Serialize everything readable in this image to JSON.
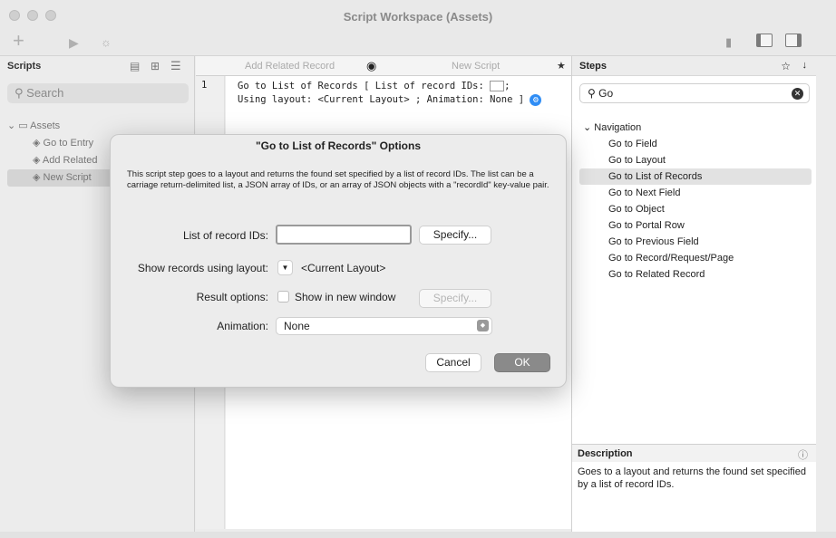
{
  "window": {
    "title": "Script Workspace (Assets)"
  },
  "scripts_panel": {
    "header": "Scripts",
    "search_placeholder": "Search",
    "folder": "Assets",
    "items": [
      "Go to Entry",
      "Add Related",
      "New Script"
    ]
  },
  "tabs": [
    {
      "label": "Add Related Record"
    },
    {
      "label": "New Script"
    }
  ],
  "editor": {
    "line_number": "1",
    "line1_text": "Go to List of Records [ List of record IDs:",
    "line1_end": ";",
    "line2_text": "Using layout: <Current Layout> ; Animation: None ]"
  },
  "steps_panel": {
    "header": "Steps",
    "search_value": "Go",
    "group": "Navigation",
    "items": [
      "Go to Field",
      "Go to Layout",
      "Go to List of Records",
      "Go to Next Field",
      "Go to Object",
      "Go to Portal Row",
      "Go to Previous Field",
      "Go to Record/Request/Page",
      "Go to Related Record"
    ],
    "selected_index": 2,
    "description_header": "Description",
    "description": "Goes to a layout and returns the found set specified by a list of record IDs."
  },
  "dialog": {
    "title": "\"Go to List of Records\" Options",
    "description": "This script step goes to a layout and returns the found set specified by a list of record IDs. The list can be a carriage return-delimited list, a JSON array of IDs, or an array of JSON objects with a \"recordId\" key-value pair.",
    "ids_label": "List of record IDs:",
    "ids_value": "",
    "specify_label": "Specify...",
    "layout_label": "Show records using layout:",
    "layout_value": "<Current Layout>",
    "result_label": "Result options:",
    "new_window_label": "Show in new window",
    "new_window_checked": false,
    "specify_disabled_label": "Specify...",
    "animation_label": "Animation:",
    "animation_value": "None",
    "cancel_label": "Cancel",
    "ok_label": "OK"
  },
  "colors": {
    "accent": "#2f8df5",
    "ok_button": "#8a8a8a",
    "selection": "#e2e2e2"
  }
}
